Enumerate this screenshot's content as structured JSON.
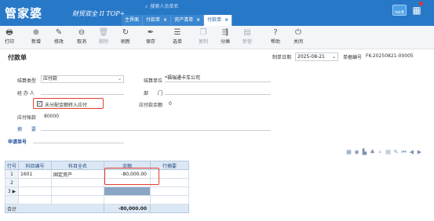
{
  "header": {
    "logo": "管家婆",
    "logo_sub": "财贸双全 II TOP+",
    "search_placeholder": "搜索人员单名",
    "tabs": [
      {
        "label": "主界面",
        "closable": false,
        "active": false
      },
      {
        "label": "付款单",
        "closable": true,
        "active": false
      },
      {
        "label": "资产清单",
        "closable": true,
        "active": false
      },
      {
        "label": "付款单",
        "closable": true,
        "active": true
      }
    ],
    "right_badge": "待处置",
    "accent_color": "#2878c8"
  },
  "toolbar": {
    "items": [
      {
        "label": "打印",
        "icon": "printer-icon",
        "enabled": true
      },
      {
        "label": "新增",
        "icon": "plus-circle-icon",
        "enabled": true
      },
      {
        "label": "修改",
        "icon": "edit-icon",
        "enabled": true
      },
      {
        "label": "取消",
        "icon": "cancel-icon",
        "enabled": true
      },
      {
        "label": "删除",
        "icon": "trash-icon",
        "enabled": false
      },
      {
        "label": "刷新",
        "icon": "refresh-icon",
        "enabled": true
      },
      {
        "label": "保存",
        "icon": "pen-icon",
        "enabled": true
      },
      {
        "label": "选单",
        "icon": "select-icon",
        "enabled": true
      },
      {
        "label": "复制",
        "icon": "copy-icon",
        "enabled": false
      },
      {
        "label": "分摊",
        "icon": "split-icon",
        "enabled": true
      },
      {
        "label": "新营",
        "icon": "doc-icon",
        "enabled": false
      },
      {
        "label": "帮助",
        "icon": "help-icon",
        "enabled": true
      },
      {
        "label": "关闭",
        "icon": "power-icon",
        "enabled": true
      }
    ]
  },
  "form": {
    "title": "付款单",
    "doc_date_label": "制单日期",
    "doc_date": "2025-08-21",
    "doc_no_label": "单据编号",
    "doc_no": "FK-20250821-00005",
    "settle_type_label": "结算类型",
    "settle_type": "应付款",
    "settle_unit_label": "结算单位",
    "settle_unit": "*福瑞通卡车公司",
    "handler_label": "经 办 人",
    "handler": "",
    "dept_label": "部　　门",
    "dept": "",
    "checkbox_label": "未分配金额转入应付",
    "checkbox_checked": true,
    "payable_balance_label": "应付款余额",
    "payable_balance": "0",
    "payable_amount_label": "应付账款",
    "payable_amount": "80000",
    "summary_label": "摘　　要",
    "summary": "",
    "request_no_label": "申请单号",
    "request_no": ""
  },
  "grid": {
    "columns": [
      "行号",
      "科目编号",
      "科目全名",
      "金额",
      "行摘要"
    ],
    "rows": [
      {
        "no": "1",
        "code": "1601",
        "name": "固定资产",
        "amount": "-80,000.00",
        "memo": ""
      },
      {
        "no": "2",
        "code": "",
        "name": "",
        "amount": "",
        "memo": ""
      },
      {
        "no": "3",
        "code": "",
        "name": "",
        "amount": "",
        "memo": ""
      }
    ],
    "total_label": "合计",
    "total_amount": "-80,000.00",
    "tool_icons": [
      "grid-icon",
      "eye-icon",
      "chart-icon",
      "tree-icon",
      "search-icon",
      "doc-icon",
      "edit-icon",
      "first-icon",
      "prev-icon",
      "next-icon"
    ]
  }
}
